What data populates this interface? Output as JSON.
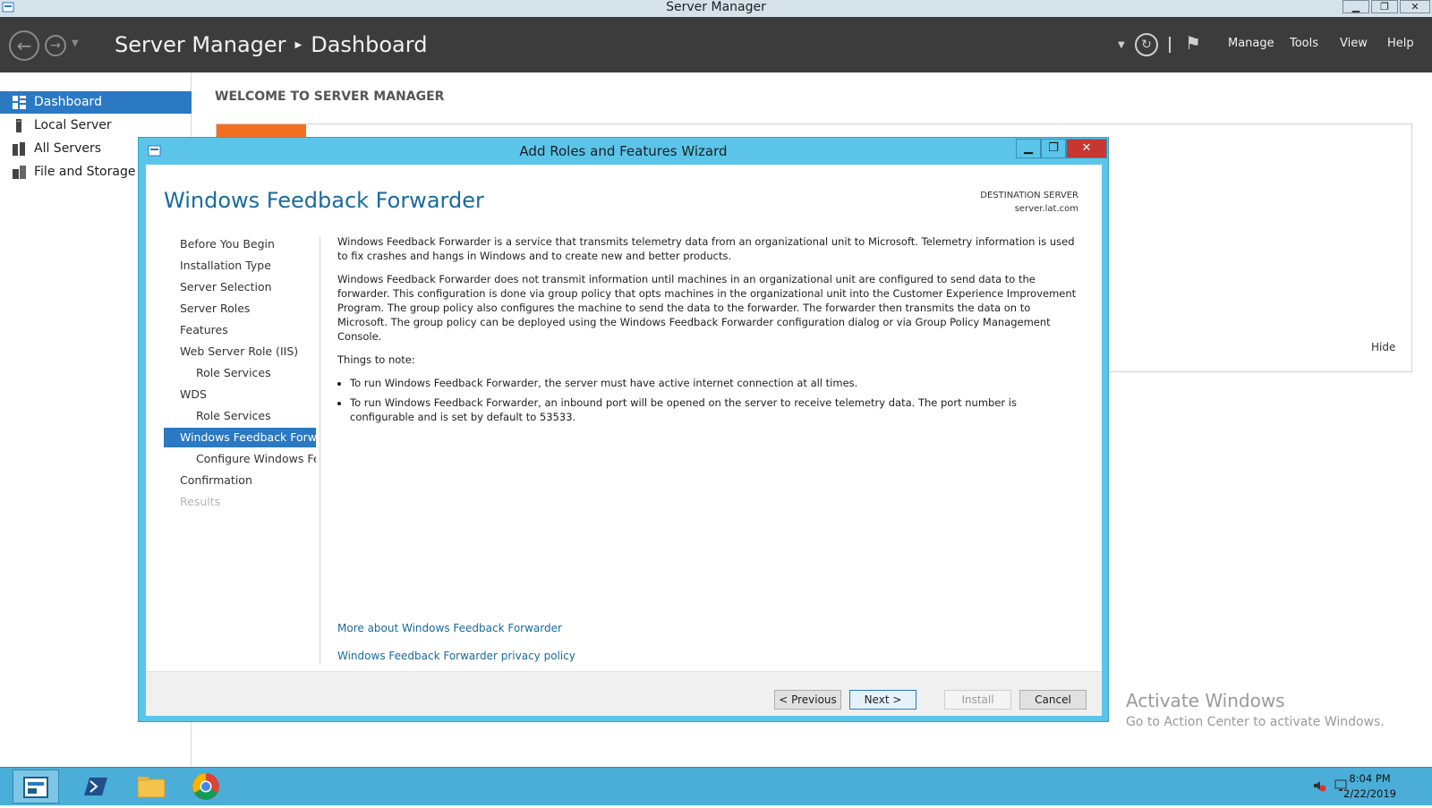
{
  "window": {
    "title": "Server Manager",
    "controls": {
      "minimize": "▁",
      "restore": "❐",
      "close": "✕"
    }
  },
  "header": {
    "breadcrumb_root": "Server Manager",
    "breadcrumb_current": "Dashboard",
    "menu": {
      "manage": "Manage",
      "tools": "Tools",
      "view": "View",
      "help": "Help"
    }
  },
  "sidebar": {
    "items": [
      {
        "label": "Dashboard",
        "icon": "dashboard-icon",
        "active": true
      },
      {
        "label": "Local Server",
        "icon": "server-icon",
        "active": false
      },
      {
        "label": "All Servers",
        "icon": "servers-icon",
        "active": false
      },
      {
        "label": "File and Storage Services",
        "icon": "storage-icon",
        "active": false
      }
    ]
  },
  "main": {
    "welcome_title": "WELCOME TO SERVER MANAGER",
    "hide_label": "Hide"
  },
  "wizard": {
    "title": "Add Roles and Features Wizard",
    "heading": "Windows Feedback Forwarder",
    "destination_label": "DESTINATION SERVER",
    "destination_server": "server.lat.com",
    "steps": [
      {
        "label": "Before You Begin",
        "level": 0,
        "state": "normal"
      },
      {
        "label": "Installation Type",
        "level": 0,
        "state": "normal"
      },
      {
        "label": "Server Selection",
        "level": 0,
        "state": "normal"
      },
      {
        "label": "Server Roles",
        "level": 0,
        "state": "normal"
      },
      {
        "label": "Features",
        "level": 0,
        "state": "normal"
      },
      {
        "label": "Web Server Role (IIS)",
        "level": 0,
        "state": "normal"
      },
      {
        "label": "Role Services",
        "level": 1,
        "state": "normal"
      },
      {
        "label": "WDS",
        "level": 0,
        "state": "normal"
      },
      {
        "label": "Role Services",
        "level": 1,
        "state": "normal"
      },
      {
        "label": "Windows Feedback Forw...",
        "level": 0,
        "state": "active"
      },
      {
        "label": "Configure Windows Fe...",
        "level": 1,
        "state": "normal"
      },
      {
        "label": "Confirmation",
        "level": 0,
        "state": "normal"
      },
      {
        "label": "Results",
        "level": 0,
        "state": "disabled"
      }
    ],
    "paragraph1": "Windows Feedback Forwarder is a service that transmits telemetry data from an organizational unit to Microsoft.   Telemetry information is used to fix crashes and hangs in Windows and to create new and better products.",
    "paragraph2": "Windows Feedback Forwarder does not transmit information until machines in an organizational unit are configured to send data to the forwarder.  This configuration is done via group policy that opts machines in the organizational unit into the Customer Experience Improvement Program.  The group policy also configures the machine to send the data to the forwarder.  The forwarder then transmits the data on to Microsoft.  The group policy can be deployed using the Windows Feedback Forwarder configuration dialog or via Group Policy Management Console.",
    "notes_title": "Things to note:",
    "notes": [
      "To run Windows Feedback Forwarder, the server must have active internet connection at all times.",
      "To run Windows Feedback Forwarder, an inbound port will be opened on the server to receive telemetry data. The port number is configurable and is set by default to 53533."
    ],
    "link_more": "More about Windows Feedback Forwarder",
    "link_privacy": "Windows Feedback Forwarder privacy policy",
    "buttons": {
      "previous": "< Previous",
      "next": "Next >",
      "install": "Install",
      "cancel": "Cancel"
    }
  },
  "watermark": {
    "line1": "Activate Windows",
    "line2": "Go to Action Center to activate Windows."
  },
  "taskbar": {
    "apps": [
      "server-manager-icon",
      "powershell-icon",
      "file-explorer-icon",
      "chrome-icon"
    ],
    "time": "8:04 PM",
    "date": "2/22/2019"
  },
  "colors": {
    "accent": "#2b79c2",
    "wizard_frame": "#5bc5e9",
    "header_bg": "#3c3c3c",
    "orange_tile": "#f26f21",
    "taskbar": "#4aaed8"
  }
}
